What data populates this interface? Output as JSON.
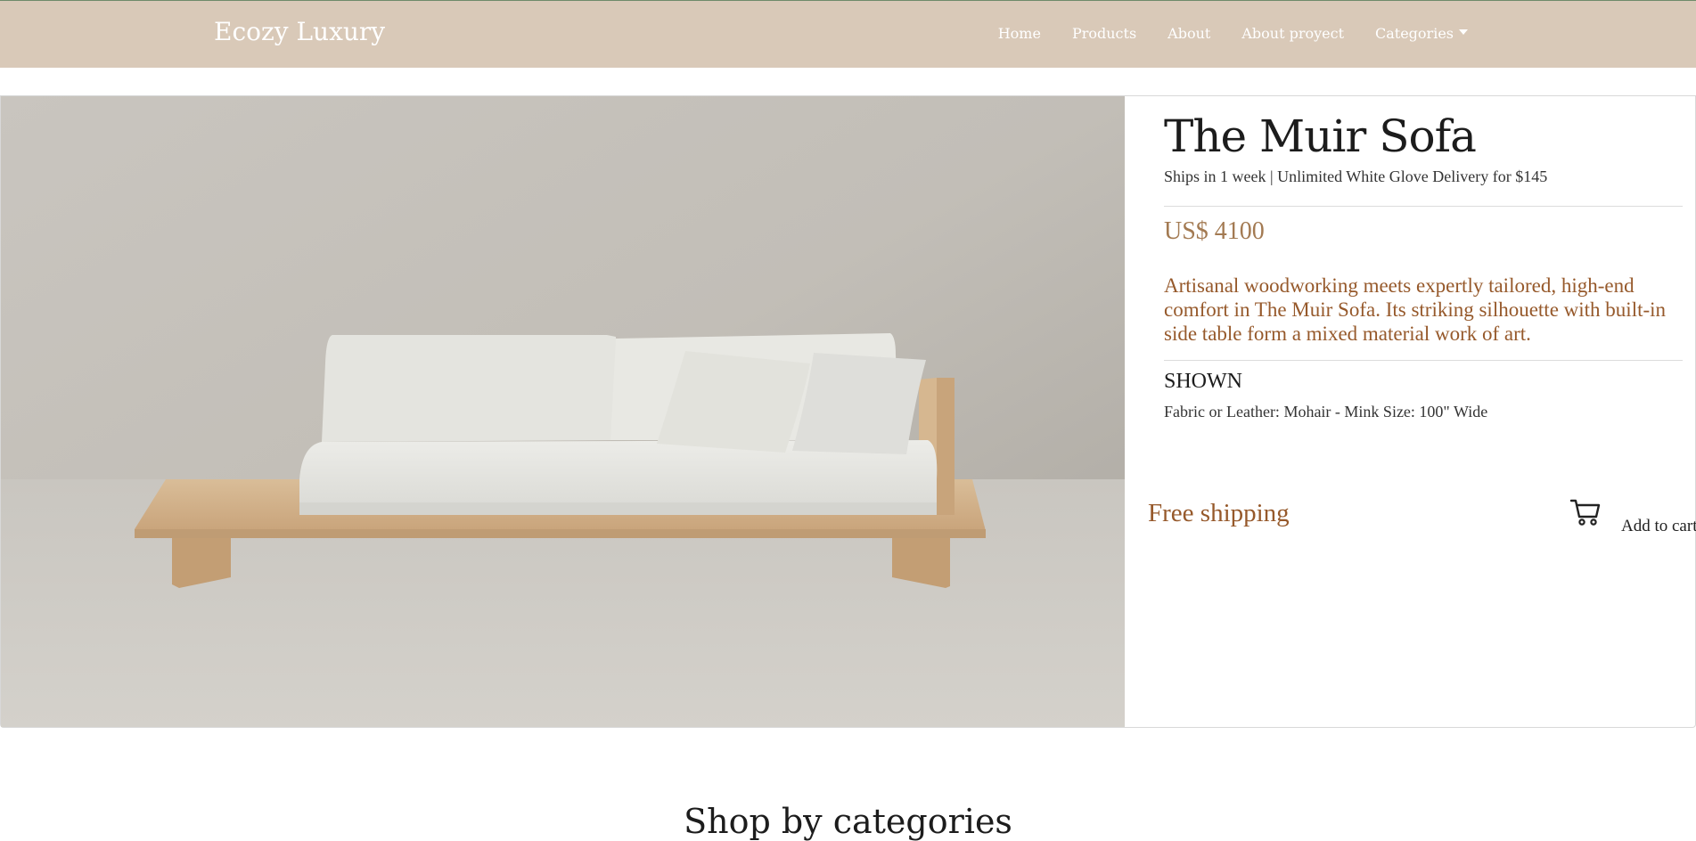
{
  "navbar": {
    "brand": "Ecozy Luxury",
    "links": [
      "Home",
      "Products",
      "About",
      "About proyect",
      "Categories"
    ],
    "background": "#d9c9b8"
  },
  "product": {
    "image_icon": "sofa-photo",
    "title": "The Muir Sofa",
    "ship_note": "Ships in 1 week | Unlimited White Glove Delivery for $145",
    "price": "US$ 4100",
    "description": "Artisanal woodworking meets expertly tailored, high-end comfort in The Muir Sofa. Its striking silhouette with built-in side table form a mixed material work of art.",
    "shown_heading": "SHOWN",
    "shown_spec": "Fabric or Leather: Mohair - Mink Size: 100\" Wide",
    "free_shipping": "Free shipping",
    "cart_icon": "cart-icon",
    "add_to_cart": "Add to cart",
    "price_color": "#a37a52",
    "accent_color": "#96592b"
  },
  "sections": {
    "shop_by_categories": "Shop by categories"
  }
}
